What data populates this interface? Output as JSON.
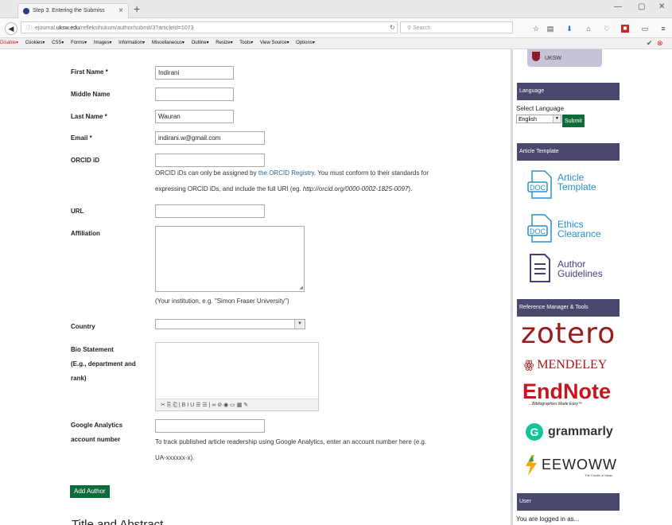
{
  "browser": {
    "tab_title": "Step 3. Entering the Submiss",
    "url_prefix": "ejournal.",
    "url_domain": "uksw.edu",
    "url_path": "/refleksihukum/author/submit/3?articleId=1073",
    "search_placeholder": "Search",
    "new_tab": "+",
    "close_tab": "×"
  },
  "devbar": {
    "items": [
      "Disable▾",
      "Cookies▾",
      "CSS▾",
      "Forms▾",
      "Images▾",
      "Information▾",
      "Miscellaneous▾",
      "Outline▾",
      "Resize▾",
      "Tools▾",
      "View Source▾",
      "Options▾"
    ]
  },
  "form": {
    "first_name_label": "First Name *",
    "first_name_value": "Indirani",
    "middle_name_label": "Middle Name",
    "middle_name_value": "",
    "last_name_label": "Last Name *",
    "last_name_value": "Wauran",
    "email_label": "Email *",
    "email_value": "indirani.w@gmail.com",
    "orcid_label": "ORCID iD",
    "orcid_value": "",
    "orcid_help_1": "ORCID iDs can only be assigned by ",
    "orcid_help_link": "the ORCID Registry",
    "orcid_help_2": ". You must conform to their standards for",
    "orcid_help_3": "expressing ORCID iDs, and include the full URI (eg. ",
    "orcid_help_example": "http://orcid.org/0000-0002-1825-0097",
    "orcid_help_4": ").",
    "url_label": "URL",
    "url_value": "",
    "affiliation_label": "Affiliation",
    "affiliation_help": "(Your institution, e.g. \"Simon Fraser University\")",
    "country_label": "Country",
    "bio_label_1": "Bio Statement",
    "bio_label_2": "(E.g., department and",
    "bio_label_3": "rank)",
    "editor_toolbar": "✂ ⎘ ⎗ | B I U ☰ ☰ | ∞ ⊘ ◉ ▭ ▦ ✎",
    "ga_label_1": "Google Analytics",
    "ga_label_2": "account number",
    "ga_value": "",
    "ga_help_1": "To track published article readership using Google Analytics, enter an account number here (e.g.",
    "ga_help_2": "UA-xxxxxx-x).",
    "add_author_button": "Add Author",
    "next_section_title": "Title and Abstract"
  },
  "sidebar": {
    "top_logo_text": "UKSW",
    "language_heading": "Language",
    "select_language_label": "Select Language",
    "language_value": "English",
    "submit_button": "Submit",
    "article_template_heading": "Article Template",
    "doc_items": [
      {
        "line1": "Article",
        "line2": "Template",
        "badge": "DOC"
      },
      {
        "line1": "Ethics",
        "line2": "Clearance",
        "badge": "DOC"
      },
      {
        "line1": "Author",
        "line2": "Guidelines",
        "badge": ""
      }
    ],
    "ref_heading": "Reference Manager & Tools",
    "zotero": "zotero",
    "mendeley": "MENDELEY",
    "endnote": "EndNote",
    "endnote_tagline": "...Bibliographies Made Easy™",
    "grammarly": "grammarly",
    "eewoww": "EEWOWW",
    "eewoww_tagline": "The Cradle of Ideas",
    "user_heading": "User",
    "logged_in_text": "You are logged in as..."
  },
  "colors": {
    "sidebar_heading_bg": "#49496e",
    "button_green": "#0f6b3b",
    "link_blue": "#2a6496"
  }
}
